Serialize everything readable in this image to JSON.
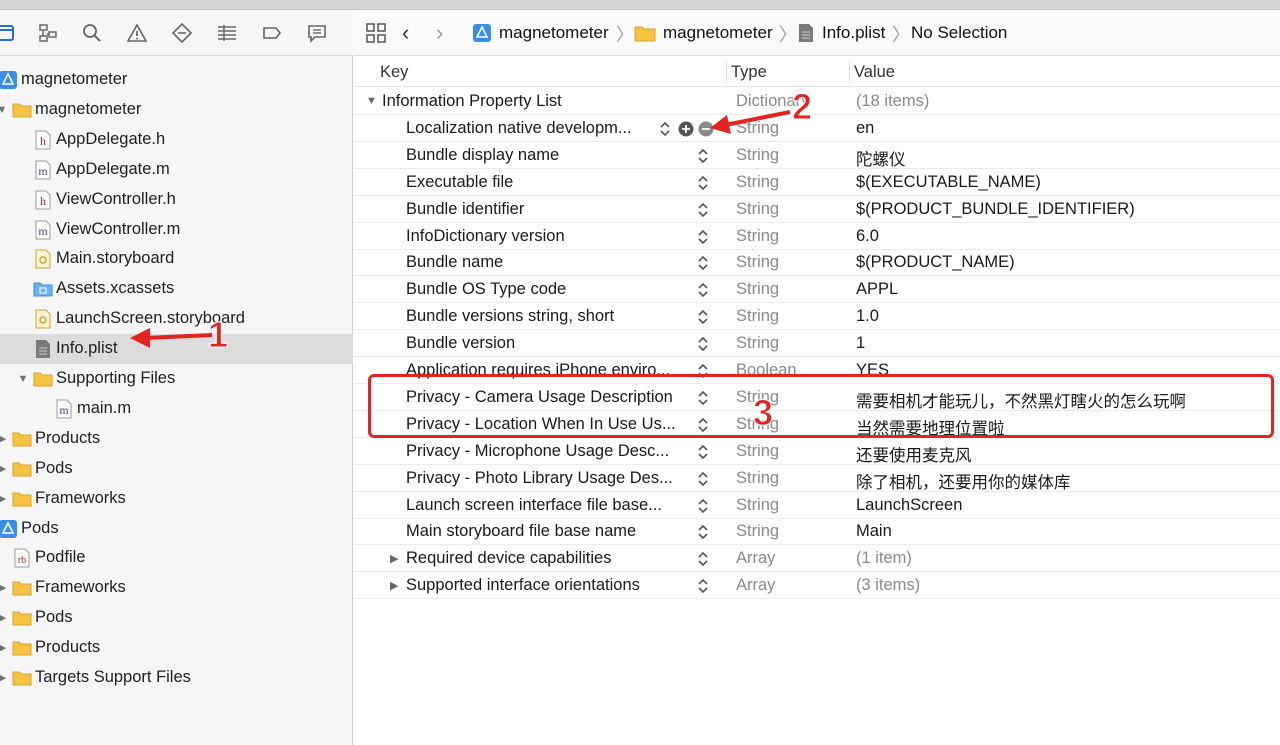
{
  "navigator": {
    "tree": [
      {
        "label": "magnetometer",
        "icon": "project-icon",
        "level": 0,
        "disclosure": ""
      },
      {
        "label": "magnetometer",
        "icon": "folder-icon",
        "level": 1,
        "disclosure": "open"
      },
      {
        "label": "AppDelegate.h",
        "icon": "h-file-icon",
        "level": 2,
        "disclosure": ""
      },
      {
        "label": "AppDelegate.m",
        "icon": "m-file-icon",
        "level": 2,
        "disclosure": ""
      },
      {
        "label": "ViewController.h",
        "icon": "h-file-icon",
        "level": 2,
        "disclosure": ""
      },
      {
        "label": "ViewController.m",
        "icon": "m-file-icon",
        "level": 2,
        "disclosure": ""
      },
      {
        "label": "Main.storyboard",
        "icon": "storyboard-icon",
        "level": 2,
        "disclosure": ""
      },
      {
        "label": "Assets.xcassets",
        "icon": "assets-folder-icon",
        "level": 2,
        "disclosure": ""
      },
      {
        "label": "LaunchScreen.storyboard",
        "icon": "storyboard-icon",
        "level": 2,
        "disclosure": ""
      },
      {
        "label": "Info.plist",
        "icon": "plist-file-icon",
        "level": 2,
        "disclosure": "",
        "selected": true
      },
      {
        "label": "Supporting Files",
        "icon": "folder-icon",
        "level": 2,
        "disclosure": "open"
      },
      {
        "label": "main.m",
        "icon": "m-file-icon",
        "level": 3,
        "disclosure": ""
      },
      {
        "label": "Products",
        "icon": "folder-icon",
        "level": 1,
        "disclosure": "closed"
      },
      {
        "label": "Pods",
        "icon": "folder-icon",
        "level": 1,
        "disclosure": "closed"
      },
      {
        "label": "Frameworks",
        "icon": "folder-icon",
        "level": 1,
        "disclosure": "closed"
      },
      {
        "label": "Pods",
        "icon": "project-icon",
        "level": 0,
        "disclosure": ""
      },
      {
        "label": "Podfile",
        "icon": "rb-file-icon",
        "level": 1,
        "disclosure": ""
      },
      {
        "label": "Frameworks",
        "icon": "folder-icon",
        "level": 1,
        "disclosure": "closed"
      },
      {
        "label": "Pods",
        "icon": "folder-icon",
        "level": 1,
        "disclosure": "closed"
      },
      {
        "label": "Products",
        "icon": "folder-icon",
        "level": 1,
        "disclosure": "closed"
      },
      {
        "label": "Targets Support Files",
        "icon": "folder-icon",
        "level": 1,
        "disclosure": "closed"
      }
    ]
  },
  "jumpbar": {
    "project": "magnetometer",
    "group": "magnetometer",
    "file": "Info.plist",
    "selection": "No Selection"
  },
  "plist": {
    "headers": {
      "key": "Key",
      "type": "Type",
      "value": "Value"
    },
    "rows": [
      {
        "key": "Information Property List",
        "type": "Dictionary",
        "value": "(18 items)",
        "root": true,
        "disclosure": "open",
        "muted": true
      },
      {
        "key": "Localization native developm...",
        "type": "String",
        "value": "en",
        "hovered": true
      },
      {
        "key": "Bundle display name",
        "type": "String",
        "value": "陀螺仪"
      },
      {
        "key": "Executable file",
        "type": "String",
        "value": "$(EXECUTABLE_NAME)"
      },
      {
        "key": "Bundle identifier",
        "type": "String",
        "value": "$(PRODUCT_BUNDLE_IDENTIFIER)"
      },
      {
        "key": "InfoDictionary version",
        "type": "String",
        "value": "6.0"
      },
      {
        "key": "Bundle name",
        "type": "String",
        "value": "$(PRODUCT_NAME)"
      },
      {
        "key": "Bundle OS Type code",
        "type": "String",
        "value": "APPL"
      },
      {
        "key": "Bundle versions string, short",
        "type": "String",
        "value": "1.0"
      },
      {
        "key": "Bundle version",
        "type": "String",
        "value": "1"
      },
      {
        "key": "Application requires iPhone enviro...",
        "type": "Boolean",
        "value": "YES"
      },
      {
        "key": "Privacy - Camera Usage Description",
        "type": "String",
        "value": "需要相机才能玩儿，不然黑灯瞎火的怎么玩啊"
      },
      {
        "key": "Privacy - Location When In Use Us...",
        "type": "String",
        "value": "当然需要地理位置啦"
      },
      {
        "key": "Privacy - Microphone Usage Desc...",
        "type": "String",
        "value": "还要使用麦克风"
      },
      {
        "key": "Privacy - Photo Library Usage Des...",
        "type": "String",
        "value": "除了相机，还要用你的媒体库"
      },
      {
        "key": "Launch screen interface file base...",
        "type": "String",
        "value": "LaunchScreen"
      },
      {
        "key": "Main storyboard file base name",
        "type": "String",
        "value": "Main"
      },
      {
        "key": "Required device capabilities",
        "type": "Array",
        "value": "(1 item)",
        "disclosure": "closed",
        "muted": true
      },
      {
        "key": "Supported interface orientations",
        "type": "Array",
        "value": "(3 items)",
        "disclosure": "closed",
        "muted": true
      }
    ]
  },
  "annotations": {
    "one": "1",
    "two": "2",
    "three": "3"
  },
  "colors": {
    "accent_red": "#e32420",
    "folder": "#f5c242",
    "selection": "#dcdcdc"
  }
}
